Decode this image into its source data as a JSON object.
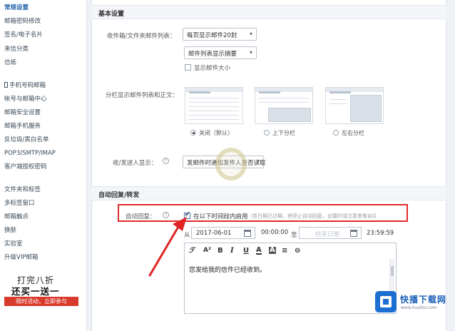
{
  "sidebar": {
    "items": [
      {
        "label": "常规设置",
        "active": true
      },
      {
        "label": "邮箱密码修改"
      },
      {
        "label": "签名/电子名片"
      },
      {
        "label": "来信分类"
      },
      {
        "label": "信纸"
      },
      {
        "label": "手机号码邮箱"
      },
      {
        "label": "帐号与邮箱中心"
      },
      {
        "label": "邮箱安全设置"
      },
      {
        "label": "邮箱手机服务"
      },
      {
        "label": "反垃圾/黑白名单"
      },
      {
        "label": "POP3/SMTP/IMAP"
      },
      {
        "label": "客户端授权密码"
      },
      {
        "label": "文件夹和标签"
      },
      {
        "label": "多标签窗口"
      },
      {
        "label": "邮箱触点"
      },
      {
        "label": "换肤"
      },
      {
        "label": "实验室"
      },
      {
        "label": "升级VIP邮箱"
      }
    ],
    "promo": {
      "line1": "打完八折",
      "line2": "还买一送一",
      "cta": "限时活动，立即参与"
    }
  },
  "basic": {
    "section_title": "基本设置",
    "list_label": "收件箱/文件夹邮件列表：",
    "per_page_select": "每页显示邮件20封",
    "list_mode_select": "邮件列表显示摘要",
    "show_size_label": "显示邮件大小",
    "layout_label": "分栏显示邮件列表和正文：",
    "layout_options": [
      {
        "label": "关闭（默认）",
        "selected": true
      },
      {
        "label": "上下分栏",
        "selected": false
      },
      {
        "label": "左右分栏",
        "selected": false
      }
    ],
    "receipt_label": "收/发送人显示：",
    "receipt_select": "发邮件时通知发件人是否读取"
  },
  "autoreply": {
    "section_title": "自动回复/转发",
    "label": "自动回复：",
    "enable_label": "在以下时间段内启用",
    "hint": "（若日期已过期，将停止自动回复，设置时请注意查看自动回复结束时间）",
    "from_label": "从",
    "start_date": "2017-06-01",
    "start_time": "00:00:00",
    "to_label": "至",
    "end_date_placeholder": "结束日期",
    "end_time": "23:59:59",
    "message": "您发给我的信件已经收到。",
    "toolbar": [
      {
        "icon": "font-icon",
        "glyph": "ℱ"
      },
      {
        "icon": "font-size-icon",
        "glyph": "A²"
      },
      {
        "icon": "bold-icon",
        "glyph": "B"
      },
      {
        "icon": "italic-icon",
        "glyph": "I"
      },
      {
        "icon": "underline-icon",
        "glyph": "U"
      },
      {
        "icon": "font-color-icon",
        "glyph": "A"
      },
      {
        "icon": "highlight-icon",
        "glyph": "A"
      },
      {
        "icon": "align-icon",
        "glyph": "≡"
      },
      {
        "icon": "link-icon",
        "glyph": "⊖"
      }
    ]
  },
  "watermark": {
    "title": "快播下载网",
    "subtitle": "www.kuaibo.com"
  },
  "colors": {
    "accent": "#1d5fa8",
    "highlight_box": "#e12b2b",
    "arrow": "#e02424"
  }
}
